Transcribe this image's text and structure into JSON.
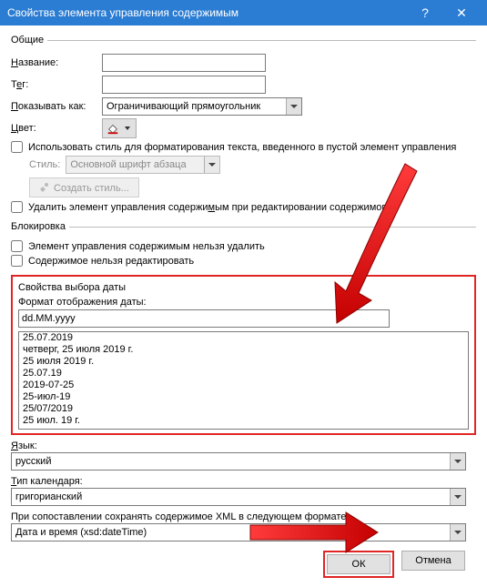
{
  "title": "Свойства элемента управления содержимым",
  "groups": {
    "general": "Общие",
    "locking": "Блокировка",
    "date": "Свойства выбора даты"
  },
  "labels": {
    "name": "Название:",
    "tag": "Тег:",
    "showAs": "Показывать как:",
    "color": "Цвет:",
    "style": "Стиль:",
    "dateFormat": "Формат отображения даты:",
    "language": "Язык:",
    "calendarType": "Тип календаря:",
    "xmlMap": "При сопоставлении сохранять содержимое XML в следующем формате:"
  },
  "values": {
    "name": "",
    "tag": "",
    "showAs": "Ограничивающий прямоугольник",
    "style": "Основной шрифт абзаца",
    "dateFormat": "dd.MM.yyyy",
    "language": "русский",
    "calendarType": "григорианский",
    "xmlMap": "Дата и время (xsd:dateTime)"
  },
  "checkboxes": {
    "useStyle": "Использовать стиль для форматирования текста, введенного в пустой элемент управления",
    "removeOnEdit": "Удалить элемент управления содержимым при редактировании содержимого",
    "noDelete": "Элемент управления содержимым нельзя удалить",
    "noEdit": "Содержимое нельзя редактировать"
  },
  "buttons": {
    "newStyle": "Создать стиль...",
    "ok": "ОК",
    "cancel": "Отмена"
  },
  "dateFormats": [
    "25.07.2019",
    "четверг, 25 июля 2019 г.",
    "25 июля 2019 г.",
    "25.07.19",
    "2019-07-25",
    "25-июл-19",
    "25/07/2019",
    "25 июл. 19 г."
  ]
}
